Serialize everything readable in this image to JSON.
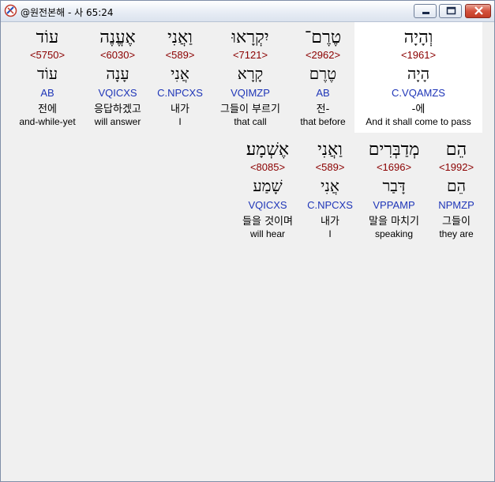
{
  "window": {
    "title": "@원전본해 - 사 65:24",
    "controls": {
      "minimize": "minimize-icon",
      "maximize": "maximize-icon",
      "close": "close-icon"
    }
  },
  "words": [
    {
      "hebrew": "וְהָיָה",
      "strong": "<1961>",
      "root": "הָיָה",
      "parse": "C.VQAMZS",
      "korean": "-에",
      "english": "And it shall come to pass",
      "selected": true
    },
    {
      "hebrew": "טֶרֶם־",
      "strong": "<2962>",
      "root": "טֶרֶם",
      "parse": "AB",
      "korean": "전-",
      "english": "that before"
    },
    {
      "hebrew": "יִקְרָאוּ",
      "strong": "<7121>",
      "root": "קָרָא",
      "parse": "VQIMZP",
      "korean": "그들이 부르기",
      "english": "that call"
    },
    {
      "hebrew": "וַאֲנִי",
      "strong": "<589>",
      "root": "אֲנִי",
      "parse": "C.NPCXS",
      "korean": "내가",
      "english": "I"
    },
    {
      "hebrew": "אֶעֱנֶה",
      "strong": "<6030>",
      "root": "עָנָה",
      "parse": "VQICXS",
      "korean": "응답하겠고",
      "english": "will answer"
    },
    {
      "hebrew": "עוֹד",
      "strong": "<5750>",
      "root": "עוֹד",
      "parse": "AB",
      "korean": "전에",
      "english": "and-while-yet"
    },
    {
      "hebrew": "הֵם",
      "strong": "<1992>",
      "root": "הֵם",
      "parse": "NPMZP",
      "korean": "그들이",
      "english": "they are"
    },
    {
      "hebrew": "מְדַבְּרִים",
      "strong": "<1696>",
      "root": "דָּבַר",
      "parse": "VPPAMP",
      "korean": "말을 마치기",
      "english": "speaking"
    },
    {
      "hebrew": "וַאֲנִי",
      "strong": "<589>",
      "root": "אֲנִי",
      "parse": "C.NPCXS",
      "korean": "내가",
      "english": "I"
    },
    {
      "hebrew": "אֶשְׁמָע׃",
      "strong": "<8085>",
      "root": "שָׁמַע",
      "parse": "VQICXS",
      "korean": "들을 것이며",
      "english": "will hear"
    }
  ]
}
